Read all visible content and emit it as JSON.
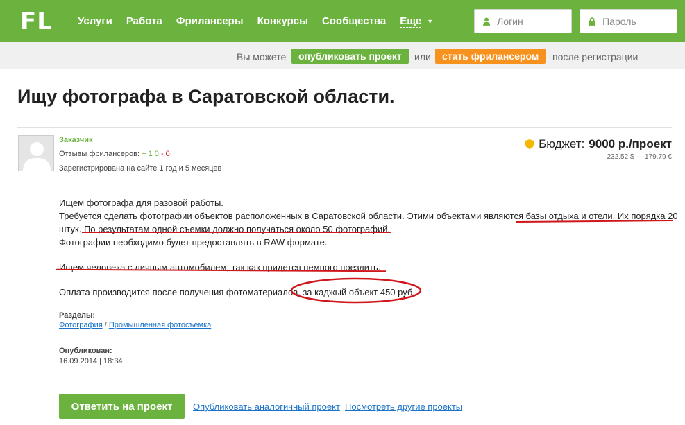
{
  "brand": {
    "logo": "FL",
    "accent": "#6bb33e",
    "orange": "#f7921e",
    "link": "#1a73c9",
    "mark": "#d0171c"
  },
  "nav": {
    "items": [
      "Услуги",
      "Работа",
      "Фрилансеры",
      "Конкурсы",
      "Сообщества"
    ],
    "more": "Еще"
  },
  "auth": {
    "login_placeholder": "Логин",
    "password_placeholder": "Пароль",
    "login_icon": "user-icon",
    "password_icon": "lock-icon"
  },
  "subbar": {
    "prefix": "Вы можете",
    "publish": "опубликовать проект",
    "or": "или",
    "freelancer": "стать фрилансером",
    "suffix": "после регистрации"
  },
  "project": {
    "title": "Ищу фотографа в Саратовской области.",
    "author": "Заказчик",
    "reviews_label": "Отзывы фрилансеров:",
    "reviews_pos": "+ 1",
    "reviews_zero": "0",
    "reviews_neg": "- 0",
    "registered": "Зарегистрирована на сайте 1 год и 5 месяцев",
    "budget_label": "Бюджет:",
    "budget_value": "9000 р./проект",
    "budget_sub": "232.52 $ — 179.79 €",
    "desc": {
      "l1": "Ищем фотографа для разовой работы.",
      "l2": "Требуется сделать фотографии объектов расположенных в Саратовской области. Этими объектами являются базы отдыха и отели. Их порядка 20",
      "l3": "штук. По результатам одной съемки должно получаться около 50 фотографий.",
      "l4": "Фотографии необходимо будет предоставлять в RAW формате.",
      "l5": "Ищем человека с личным автомобилем, так как придется немного поездить.",
      "l6": "Оплата производится после получения фотоматериалов, за каджый объект 450 руб."
    },
    "sections_label": "Разделы:",
    "section_1": "Фотография",
    "section_sep": " / ",
    "section_2": "Промышленная фотосъемка",
    "published_label": "Опубликован:",
    "published_date": "16.09.2014 | 18:34"
  },
  "actions": {
    "reply": "Ответить на проект",
    "publish_similar": "Опубликовать аналогичный проект",
    "view_other": "Посмотреть другие проекты"
  }
}
